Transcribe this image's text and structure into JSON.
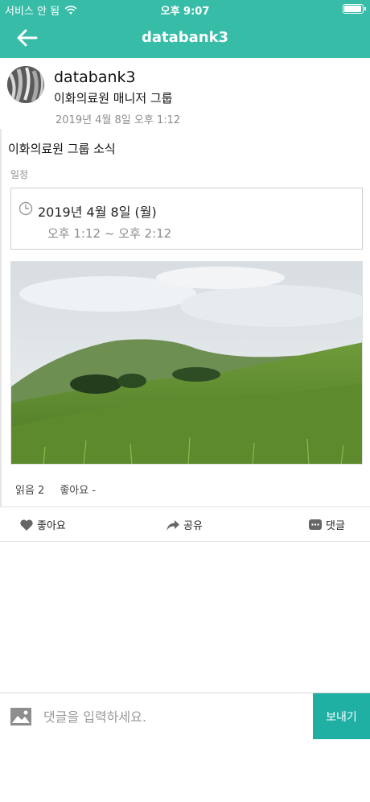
{
  "status_bar": {
    "carrier": "서비스 안 됨",
    "time": "오후 9:07"
  },
  "nav": {
    "title": "databank3"
  },
  "post": {
    "author": "databank3",
    "group": "이화의료원 매니저 그룹",
    "posted_at": "2019년 4월 8일 오후 1:12",
    "text": "이화의료원 그룹 소식",
    "schedule_label": "일정",
    "schedule_date": "2019년 4월 8일 (월)",
    "schedule_time": "오후 1:12 ~ 오후 2:12",
    "read_count": "읽음 2",
    "like_count": "좋아요 -"
  },
  "actions": {
    "like_label": "좋아요",
    "share_label": "공유",
    "comment_label": "댓글"
  },
  "comment": {
    "placeholder": "댓글을 입력하세요.",
    "send_label": "보내기"
  },
  "colors": {
    "accent": "#37bca8",
    "send_button": "#1fb0a3"
  }
}
